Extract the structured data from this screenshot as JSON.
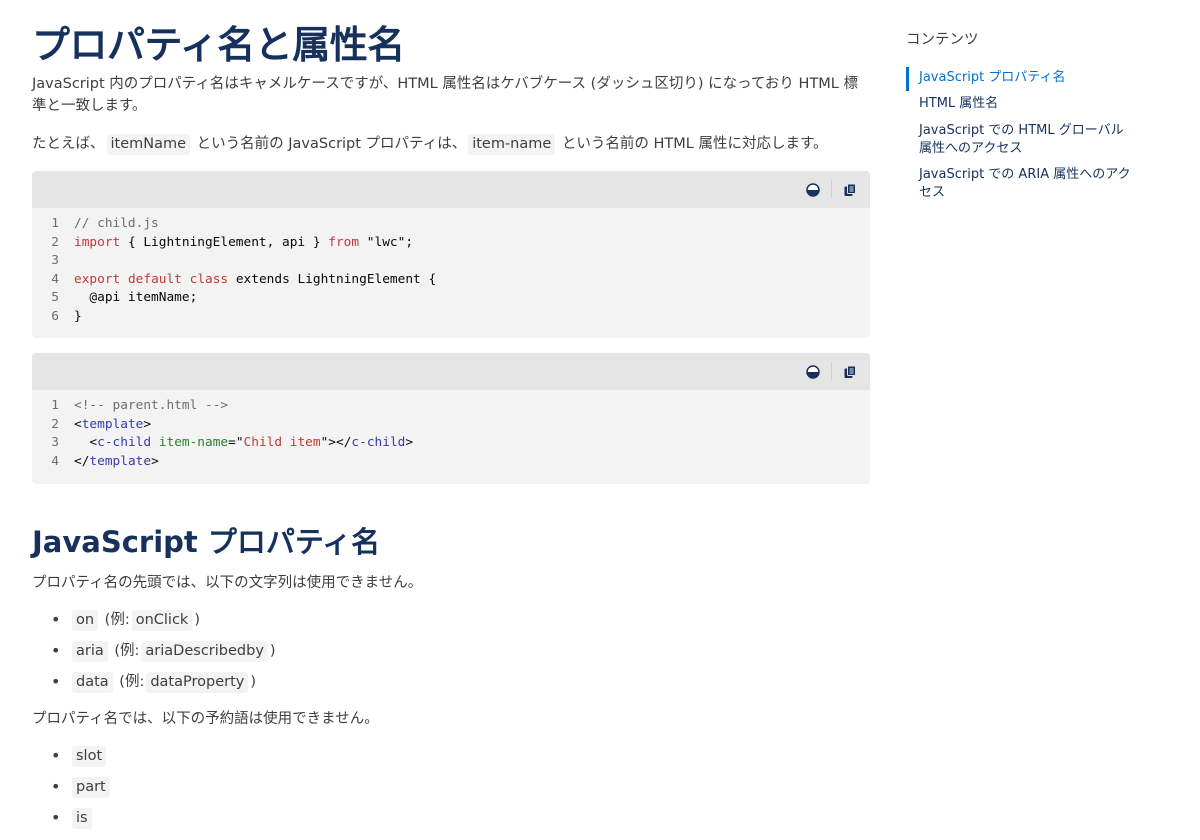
{
  "article": {
    "title": "プロパティ名と属性名",
    "intro": "JavaScript 内のプロパティ名はキャメルケースですが、HTML 属性名はケバブケース (ダッシュ区切り) になっており HTML 標準と一致します。",
    "example_prefix": "たとえば、",
    "example_prop": "itemName",
    "example_mid": "という名前の JavaScript プロパティは、",
    "example_attr": "item-name",
    "example_suffix": "という名前の HTML 属性に対応します。"
  },
  "code_blocks": [
    {
      "lines": [
        {
          "num": "1",
          "tokens": [
            {
              "t": "// child.js",
              "c": "comment"
            }
          ]
        },
        {
          "num": "2",
          "tokens": [
            {
              "t": "import",
              "c": "keyword"
            },
            {
              "t": " { LightningElement, api } ",
              "c": "plain"
            },
            {
              "t": "from",
              "c": "keyword"
            },
            {
              "t": " \"lwc\";",
              "c": "plain"
            }
          ]
        },
        {
          "num": "3",
          "tokens": []
        },
        {
          "num": "4",
          "tokens": [
            {
              "t": "export",
              "c": "keyword"
            },
            {
              "t": " ",
              "c": "plain"
            },
            {
              "t": "default",
              "c": "keyword"
            },
            {
              "t": " ",
              "c": "plain"
            },
            {
              "t": "class",
              "c": "keyword"
            },
            {
              "t": " extends LightningElement {",
              "c": "plain"
            }
          ]
        },
        {
          "num": "5",
          "tokens": [
            {
              "t": "  @api itemName;",
              "c": "plain"
            }
          ]
        },
        {
          "num": "6",
          "tokens": [
            {
              "t": "}",
              "c": "plain"
            }
          ]
        }
      ]
    },
    {
      "lines": [
        {
          "num": "1",
          "tokens": [
            {
              "t": "<!-- parent.html -->",
              "c": "comment"
            }
          ]
        },
        {
          "num": "2",
          "tokens": [
            {
              "t": "<",
              "c": "plain"
            },
            {
              "t": "template",
              "c": "tag"
            },
            {
              "t": ">",
              "c": "plain"
            }
          ]
        },
        {
          "num": "3",
          "tokens": [
            {
              "t": "  <",
              "c": "plain"
            },
            {
              "t": "c-child",
              "c": "tag"
            },
            {
              "t": " ",
              "c": "plain"
            },
            {
              "t": "item-name",
              "c": "attr"
            },
            {
              "t": "=\"",
              "c": "plain"
            },
            {
              "t": "Child item",
              "c": "attrval"
            },
            {
              "t": "\"></",
              "c": "plain"
            },
            {
              "t": "c-child",
              "c": "tag"
            },
            {
              "t": ">",
              "c": "plain"
            }
          ]
        },
        {
          "num": "4",
          "tokens": [
            {
              "t": "</",
              "c": "plain"
            },
            {
              "t": "template",
              "c": "tag"
            },
            {
              "t": ">",
              "c": "plain"
            }
          ]
        }
      ]
    }
  ],
  "section": {
    "heading": "JavaScript プロパティ名",
    "prefix_rule": "プロパティ名の先頭では、以下の文字列は使用できません。",
    "prefix_items": [
      {
        "code": "on",
        "example_label": "(例:",
        "example_code": "onClick",
        "close": ")"
      },
      {
        "code": "aria",
        "example_label": "(例:",
        "example_code": "ariaDescribedby",
        "close": ")"
      },
      {
        "code": "data",
        "example_label": "(例:",
        "example_code": "dataProperty",
        "close": ")"
      }
    ],
    "reserved_rule": "プロパティ名では、以下の予約語は使用できません。",
    "reserved_items": [
      "slot",
      "part",
      "is"
    ]
  },
  "toc": {
    "title": "コンテンツ",
    "items": [
      {
        "label": "JavaScript プロパティ名",
        "active": true
      },
      {
        "label": "HTML 属性名",
        "active": false
      },
      {
        "label": "JavaScript での HTML グローバル属性へのアクセス",
        "active": false
      },
      {
        "label": "JavaScript での ARIA 属性へのアクセス",
        "active": false
      }
    ]
  },
  "colors": {
    "heading": "#16325c",
    "body_text": "#3e3e3c",
    "accent": "#0070d2",
    "code_bg": "#f3f3f3",
    "code_toolbar_bg": "#e5e5e5"
  },
  "icons": {
    "theme_toggle": "theme-toggle-icon",
    "copy": "copy-icon"
  }
}
